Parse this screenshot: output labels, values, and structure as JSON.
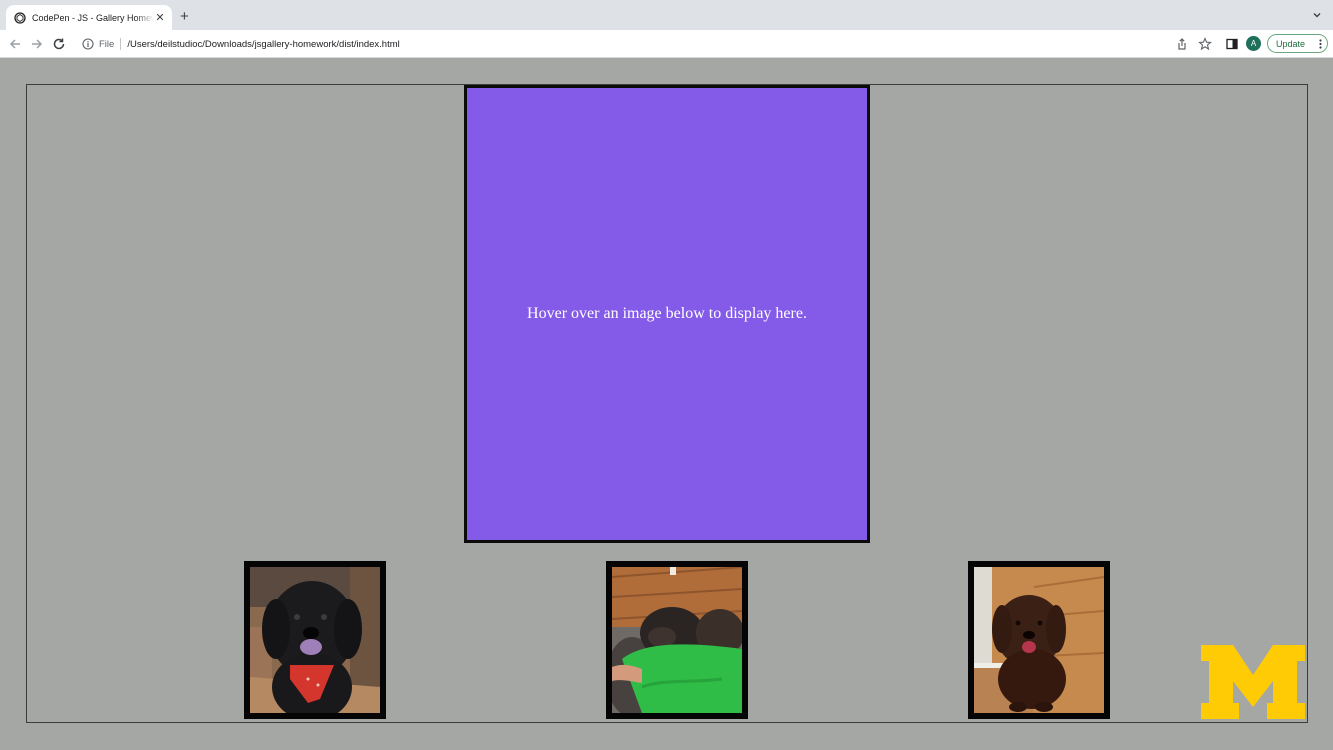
{
  "browser": {
    "tab_title": "CodePen - JS - Gallery Homework",
    "url_scheme": "File",
    "url_path": "/Users/deilstudioc/Downloads/jsgallery-homework/dist/index.html",
    "avatar_initial": "A",
    "update_label": "Update"
  },
  "gallery": {
    "display_message": "Hover over an image below to display here.",
    "display_color": "#845ae9",
    "thumbnails": [
      {
        "name": "black-dog-red-bandana"
      },
      {
        "name": "dog-and-child-green-shirt"
      },
      {
        "name": "brown-dog-sitting"
      }
    ]
  },
  "colors": {
    "page_background": "#a5a7a4",
    "display_border": "#0b0b0b",
    "logo_maize": "#ffcb05"
  }
}
